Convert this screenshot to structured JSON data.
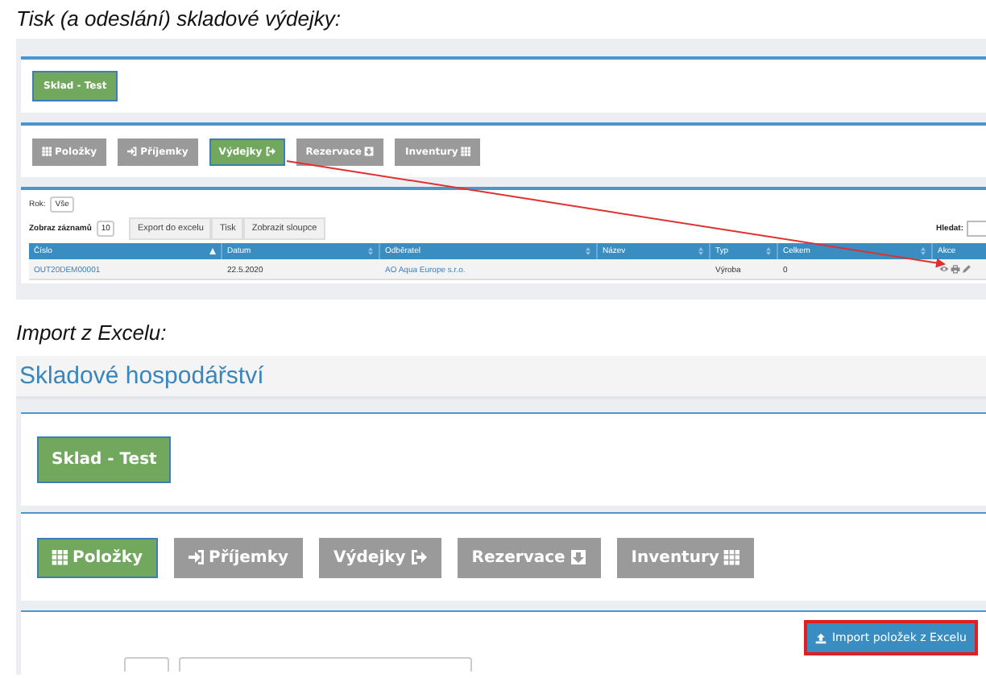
{
  "print_section": {
    "caption": "Tisk (a odeslání) skladové výdejky:",
    "warehouse_button": "Sklad - Test",
    "modules": [
      {
        "label": "Položky",
        "selected": false
      },
      {
        "label": "Příjemky",
        "selected": false
      },
      {
        "label": "Výdejky",
        "selected": true
      },
      {
        "label": "Rezervace",
        "selected": false
      },
      {
        "label": "Inventury",
        "selected": false
      }
    ],
    "year_label": "Rok:",
    "year_value": "Vše",
    "page_size_label": "Zobraz záznamů",
    "page_size": "10",
    "toolbar": [
      "Export do excelu",
      "Tisk",
      "Zobrazit sloupce"
    ],
    "search_label": "Hledat:",
    "columns": [
      {
        "label": "Číslo",
        "sorted": true
      },
      {
        "label": "Datum",
        "sorted": false
      },
      {
        "label": "Odběratel",
        "sorted": false
      },
      {
        "label": "Název",
        "sorted": false
      },
      {
        "label": "Typ",
        "sorted": false
      },
      {
        "label": "Celkem",
        "sorted": false
      },
      {
        "label": "Akce"
      }
    ],
    "rows": [
      {
        "cells": [
          {
            "text": "OUT20DEM00001",
            "link": true
          },
          {
            "text": "22.5.2020",
            "link": false
          },
          {
            "text": "AO Aqua Europe s.r.o.",
            "link": true
          },
          {
            "text": ""
          },
          {
            "text": "Výroba",
            "link": false
          },
          {
            "text": "0",
            "link": false
          }
        ]
      }
    ]
  },
  "import_section": {
    "caption": "Import z Excelu:",
    "app_title": "Skladové hospodářství",
    "warehouse_button": "Sklad - Test",
    "modules": [
      {
        "label": "Položky",
        "selected": true
      },
      {
        "label": "Příjemky",
        "selected": false
      },
      {
        "label": "Výdejky",
        "selected": false
      },
      {
        "label": "Rezervace",
        "selected": false
      },
      {
        "label": "Inventury",
        "selected": false
      }
    ],
    "import_button": "Import položek z Excelu"
  }
}
